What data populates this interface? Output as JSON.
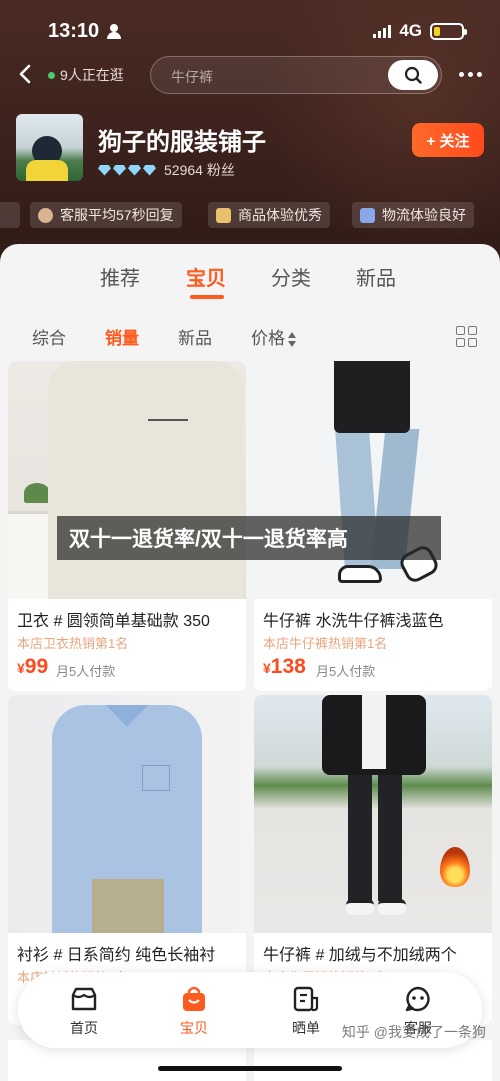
{
  "status_bar": {
    "time": "13:10",
    "network": "4G",
    "battery_level": 0.22
  },
  "nav": {
    "visitors_text": "9人正在逛",
    "search_placeholder": "牛仔裤"
  },
  "shop": {
    "name": "狗子的服装铺子",
    "fans_text": "52964 粉丝",
    "diamonds": 4,
    "follow_label": "+ 关注"
  },
  "service_tags": [
    {
      "label": "客服平均57秒回复",
      "icon": "headset-icon"
    },
    {
      "label": "商品体验优秀",
      "icon": "bag-icon"
    },
    {
      "label": "物流体验良好",
      "icon": "truck-icon"
    }
  ],
  "tabs": [
    "推荐",
    "宝贝",
    "分类",
    "新品"
  ],
  "active_tab": "宝贝",
  "sort_options": [
    "综合",
    "销量",
    "新品",
    "价格"
  ],
  "active_sort": "销量",
  "products": [
    {
      "title": "卫衣 # 圆领简单基础款 350",
      "rank": "本店卫衣热销第1名",
      "currency": "¥",
      "price": "99",
      "paid": "月5人付款"
    },
    {
      "title": "牛仔裤 水洗牛仔裤浅蓝色",
      "rank": "本店牛仔裤热销第1名",
      "currency": "¥",
      "price": "138",
      "paid": "月5人付款"
    },
    {
      "title": "衬衫 # 日系简约 纯色长袖衬",
      "rank": "本店衬衫热销第1名",
      "currency": "",
      "price": "",
      "paid": ""
    },
    {
      "title": "牛仔裤 # 加绒与不加绒两个",
      "rank": "本店牛仔裤热销第2名",
      "currency": "",
      "price": "",
      "paid": ""
    }
  ],
  "banner_text": "双十一退货率/双十一退货率高",
  "bottom_nav": [
    "首页",
    "宝贝",
    "晒单",
    "客服"
  ],
  "watermark": "知乎 @我变成了一条狗",
  "colors": {
    "accent": "#ff5a1f",
    "header_bg": "#3b211c",
    "rank_text": "#e9a57f"
  }
}
